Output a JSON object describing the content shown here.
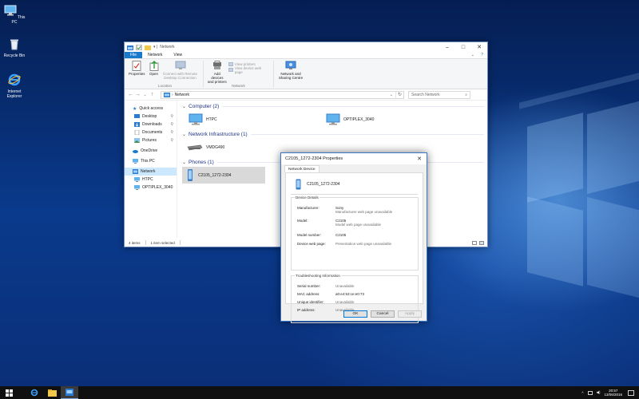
{
  "desktop": {
    "icons": [
      {
        "label": "This PC",
        "icon": "this-pc-icon"
      },
      {
        "label": "Recycle Bin",
        "icon": "recycle-bin-icon"
      },
      {
        "label": "Internet Explorer",
        "icon": "internet-explorer-icon"
      }
    ]
  },
  "explorer": {
    "title": "Network",
    "tabs": [
      "File",
      "Network",
      "View"
    ],
    "ribbon": {
      "location_group": {
        "label": "Location",
        "properties": "Properties",
        "open": "Open",
        "connect_remote": "Connect with Remote Desktop Connection"
      },
      "network_group": {
        "label": "Network",
        "add_devices": "Add devices and printers",
        "view_printers": "View printers",
        "view_device_web_page": "View device web page",
        "network_sharing": "Network and Sharing Centre"
      }
    },
    "address": {
      "path": "Network",
      "search_placeholder": "Search Network"
    },
    "nav_pane": [
      {
        "label": "Quick access",
        "icon": "star-icon",
        "level": 0
      },
      {
        "label": "Desktop",
        "icon": "desktop-folder-icon",
        "level": 1,
        "pinned": true
      },
      {
        "label": "Downloads",
        "icon": "downloads-folder-icon",
        "level": 1,
        "pinned": true
      },
      {
        "label": "Documents",
        "icon": "documents-folder-icon",
        "level": 1,
        "pinned": true
      },
      {
        "label": "Pictures",
        "icon": "pictures-folder-icon",
        "level": 1,
        "pinned": true
      },
      {
        "label": "OneDrive",
        "icon": "onedrive-icon",
        "level": 0
      },
      {
        "label": "This PC",
        "icon": "computer-icon",
        "level": 0
      },
      {
        "label": "Network",
        "icon": "network-icon",
        "level": 0,
        "selected": true
      },
      {
        "label": "HTPC",
        "icon": "computer-icon",
        "level": 1
      },
      {
        "label": "OPTIPLEX_3040",
        "icon": "computer-icon",
        "level": 1
      }
    ],
    "groups": {
      "computer": {
        "header": "Computer (2)",
        "items": [
          "HTPC",
          "OPTIPLEX_3040"
        ]
      },
      "infrastructure": {
        "header": "Network Infrastructure (1)",
        "items": [
          "VMDG490"
        ]
      },
      "phones": {
        "header": "Phones (1)",
        "items": [
          "C2105_1272-2304"
        ]
      }
    },
    "status": {
      "count": "4 items",
      "selection": "1 item selected"
    }
  },
  "dialog": {
    "title": "C2105_1272-2304 Properties",
    "tab": "Network Device",
    "device_name": "C2105_1272-2304",
    "device_details": {
      "legend": "Device Details",
      "manufacturer_label": "Manufacturer:",
      "manufacturer_value": "Sony",
      "manufacturer_note": "Manufacturer web page unavailable",
      "model_label": "Model:",
      "model_value": "C2105",
      "model_note": "Model web page unavailable",
      "model_number_label": "Model number:",
      "model_number_value": "C2105",
      "web_page_label": "Device web page:",
      "web_page_value": "Presentation web page unavailable"
    },
    "troubleshooting": {
      "legend": "Troubleshooting Information",
      "serial_label": "Serial number:",
      "serial_value": "Unavailable",
      "mac_label": "MAC address:",
      "mac_value": "a0:e4:53:ce:e0:73",
      "uid_label": "Unique identifier:",
      "uid_value": "Unavailable",
      "ip_label": "IP address:",
      "ip_value": "Unavailable"
    },
    "buttons": {
      "ok": "OK",
      "cancel": "Cancel",
      "apply": "Apply"
    }
  },
  "taskbar": {
    "time": "20:57",
    "date": "13/06/2016"
  },
  "colors": {
    "accent": "#1979ca",
    "selection": "#cce8ff",
    "group_header": "#1e3287"
  }
}
